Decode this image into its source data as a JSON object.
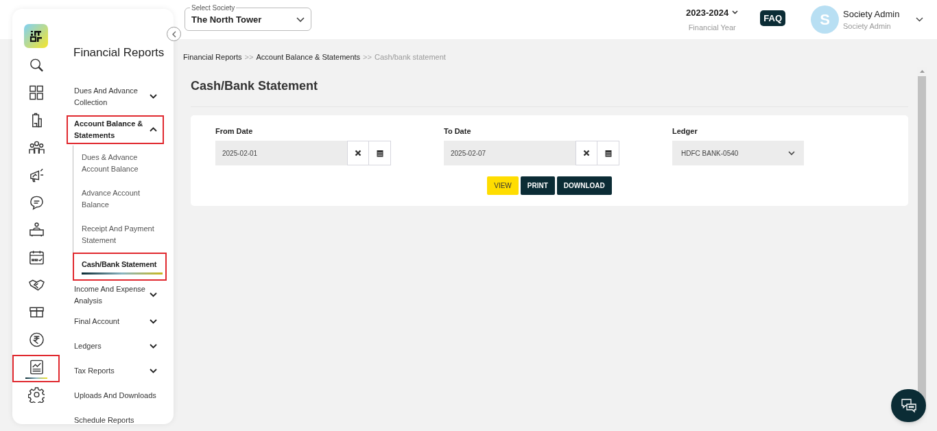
{
  "header": {
    "society_select": {
      "label": "Select Society",
      "value": "The North Tower"
    },
    "financial_year": {
      "value": "2023-2024",
      "caption": "Financial Year"
    },
    "faq": "FAQ",
    "user": {
      "initial": "S",
      "name": "Society Admin",
      "role": "Society Admin"
    }
  },
  "rail": [
    {
      "kind": "search",
      "selected": false,
      "highlighted": false
    },
    {
      "kind": "dashboard",
      "selected": false,
      "highlighted": false
    },
    {
      "kind": "building",
      "selected": false,
      "highlighted": false
    },
    {
      "kind": "people",
      "selected": false,
      "highlighted": false
    },
    {
      "kind": "megaphone",
      "selected": false,
      "highlighted": false
    },
    {
      "kind": "chat",
      "selected": false,
      "highlighted": false
    },
    {
      "kind": "desk",
      "selected": false,
      "highlighted": false
    },
    {
      "kind": "calendar",
      "selected": false,
      "highlighted": false
    },
    {
      "kind": "handshake",
      "selected": false,
      "highlighted": false
    },
    {
      "kind": "box",
      "selected": false,
      "highlighted": false
    },
    {
      "kind": "rupee",
      "selected": false,
      "highlighted": false
    },
    {
      "kind": "report",
      "selected": true,
      "highlighted": true
    },
    {
      "kind": "settings",
      "selected": false,
      "highlighted": false
    }
  ],
  "menu": {
    "title": "Financial Reports",
    "items": [
      {
        "label": "Dues And Advance Collection",
        "kind": "group",
        "expanded": false,
        "highlighted": false
      },
      {
        "label": "Account Balance & Statements",
        "kind": "group",
        "expanded": true,
        "highlighted": true,
        "children": [
          {
            "label": "Dues & Advance Account Balance",
            "selected": false,
            "highlighted": false
          },
          {
            "label": "Advance Account Balance",
            "selected": false,
            "highlighted": false
          },
          {
            "label": "Receipt And Payment Statement",
            "selected": false,
            "highlighted": false
          },
          {
            "label": "Cash/Bank Statement",
            "selected": true,
            "highlighted": true
          }
        ]
      },
      {
        "label": "Income And Expense Analysis",
        "kind": "group",
        "expanded": false,
        "highlighted": false
      },
      {
        "label": "Final Account",
        "kind": "group",
        "expanded": false,
        "highlighted": false
      },
      {
        "label": "Ledgers",
        "kind": "group",
        "expanded": false,
        "highlighted": false
      },
      {
        "label": "Tax Reports",
        "kind": "group",
        "expanded": false,
        "highlighted": false
      },
      {
        "label": "Uploads And Downloads",
        "kind": "link",
        "highlighted": false
      },
      {
        "label": "Schedule Reports",
        "kind": "link",
        "highlighted": false
      }
    ]
  },
  "breadcrumb": [
    {
      "label": "Financial Reports",
      "current": false
    },
    {
      "label": "Account Balance & Statements",
      "current": false
    },
    {
      "label": "Cash/bank statement",
      "current": true
    }
  ],
  "breadcrumb_separator": ">>",
  "page_title": "Cash/Bank Statement",
  "filters": {
    "from_date": {
      "label": "From Date",
      "value": "2025-02-01"
    },
    "to_date": {
      "label": "To Date",
      "value": "2025-02-07"
    },
    "ledger": {
      "label": "Ledger",
      "value": "HDFC BANK-0540"
    }
  },
  "buttons": [
    {
      "label": "VIEW",
      "kind": "primary"
    },
    {
      "label": "PRINT",
      "kind": "dark"
    },
    {
      "label": "DOWNLOAD",
      "kind": "dark"
    }
  ]
}
